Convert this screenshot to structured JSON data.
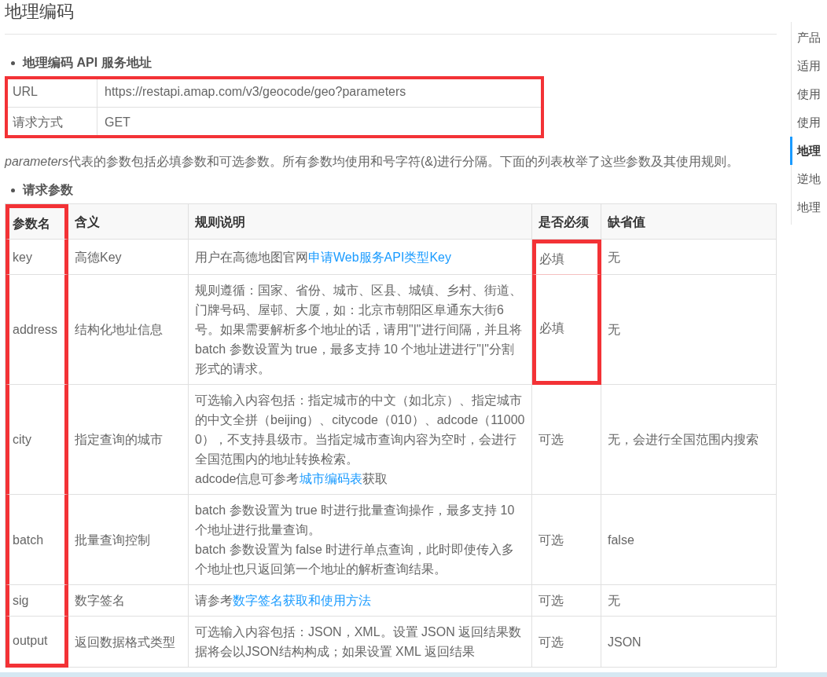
{
  "title": "地理编码",
  "sections": [
    {
      "heading": "地理编码 API 服务地址"
    },
    {
      "heading": "请求参数"
    }
  ],
  "service_table": {
    "highlighted": true,
    "rows": [
      {
        "label": "URL",
        "value": "https://restapi.amap.com/v3/geocode/geo?parameters"
      },
      {
        "label": "请求方式",
        "value": "GET"
      }
    ]
  },
  "intro": {
    "term": "parameters",
    "text": "代表的参数包括必填参数和可选参数。所有参数均使用和号字符(&)进行分隔。下面的列表枚举了这些参数及其使用规则。"
  },
  "params_table": {
    "columns": [
      {
        "label": "参数名",
        "highlighted": true
      },
      {
        "label": "含义",
        "highlighted": false
      },
      {
        "label": "规则说明",
        "highlighted": false
      },
      {
        "label": "是否必须",
        "highlighted": false
      },
      {
        "label": "缺省值",
        "highlighted": false
      }
    ],
    "rows": [
      {
        "name": "key",
        "meaning": "高德Key",
        "rule": [
          [
            {
              "text": "用户在高德地图官网",
              "link": false
            },
            {
              "text": "申请Web服务API类型Key",
              "link": true
            }
          ]
        ],
        "required": "必填",
        "required_highlighted": true,
        "default": "无"
      },
      {
        "name": "address",
        "meaning": "结构化地址信息",
        "rule": [
          [
            {
              "text": "规则遵循：国家、省份、城市、区县、城镇、乡村、街道、门牌号码、屋邨、大厦，如：北京市朝阳区阜通东大街6号。如果需要解析多个地址的话，请用\"|\"进行间隔，并且将 batch 参数设置为 true，最多支持 10 个地址进进行\"|\"分割形式的请求。",
              "link": false
            }
          ]
        ],
        "required": "必填",
        "required_highlighted": true,
        "default": "无"
      },
      {
        "name": "city",
        "meaning": "指定查询的城市",
        "rule": [
          [
            {
              "text": "可选输入内容包括：指定城市的中文（如北京）、指定城市的中文全拼（beijing）、citycode（010）、adcode（110000），不支持县级市。当指定城市查询内容为空时，会进行全国范围内的地址转换检索。",
              "link": false
            }
          ],
          [
            {
              "text": "adcode信息可参考",
              "link": false
            },
            {
              "text": "城市编码表",
              "link": true
            },
            {
              "text": "获取",
              "link": false
            }
          ]
        ],
        "required": "可选",
        "required_highlighted": false,
        "default": "无，会进行全国范围内搜索"
      },
      {
        "name": "batch",
        "meaning": "批量查询控制",
        "rule": [
          [
            {
              "text": "batch 参数设置为 true 时进行批量查询操作，最多支持 10 个地址进行批量查询。",
              "link": false
            }
          ],
          [
            {
              "text": "batch 参数设置为 false 时进行单点查询，此时即使传入多个地址也只返回第一个地址的解析查询结果。",
              "link": false
            }
          ]
        ],
        "required": "可选",
        "required_highlighted": false,
        "default": "false"
      },
      {
        "name": "sig",
        "meaning": "数字签名",
        "rule": [
          [
            {
              "text": "请参考",
              "link": false
            },
            {
              "text": "数字签名获取和使用方法",
              "link": true
            }
          ]
        ],
        "required": "可选",
        "required_highlighted": false,
        "default": "无"
      },
      {
        "name": "output",
        "meaning": "返回数据格式类型",
        "rule": [
          [
            {
              "text": "可选输入内容包括：JSON，XML。设置 JSON 返回结果数据将会以JSON结构构成；如果设置 XML 返回结果",
              "link": false
            }
          ]
        ],
        "required": "可选",
        "required_highlighted": false,
        "default": "JSON"
      }
    ]
  },
  "sidebar": {
    "items": [
      {
        "label": "产品",
        "selected": false
      },
      {
        "label": "适用",
        "selected": false
      },
      {
        "label": "使用",
        "selected": false
      },
      {
        "label": "使用",
        "selected": false
      },
      {
        "label": "地理",
        "selected": true
      },
      {
        "label": "逆地",
        "selected": false
      },
      {
        "label": "地理",
        "selected": false
      }
    ]
  }
}
